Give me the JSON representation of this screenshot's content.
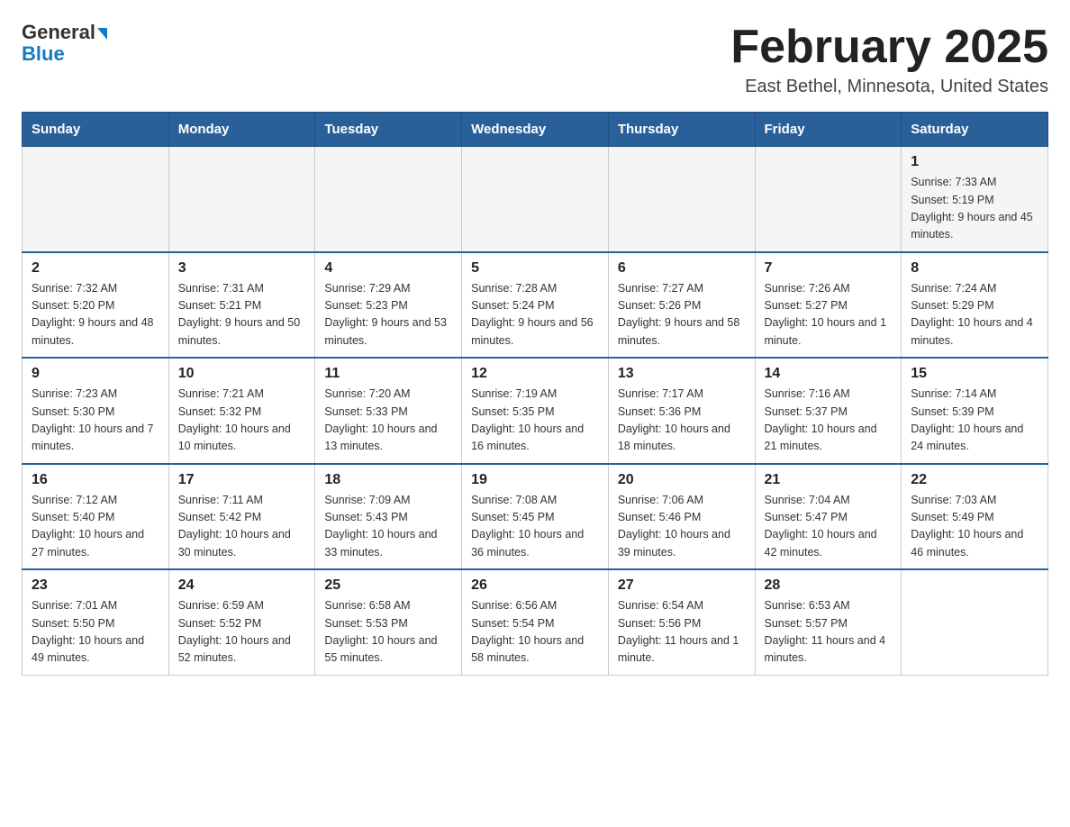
{
  "logo": {
    "line1": "General",
    "line2": "Blue"
  },
  "title": "February 2025",
  "subtitle": "East Bethel, Minnesota, United States",
  "weekdays": [
    "Sunday",
    "Monday",
    "Tuesday",
    "Wednesday",
    "Thursday",
    "Friday",
    "Saturday"
  ],
  "weeks": [
    [
      {
        "day": "",
        "info": ""
      },
      {
        "day": "",
        "info": ""
      },
      {
        "day": "",
        "info": ""
      },
      {
        "day": "",
        "info": ""
      },
      {
        "day": "",
        "info": ""
      },
      {
        "day": "",
        "info": ""
      },
      {
        "day": "1",
        "info": "Sunrise: 7:33 AM\nSunset: 5:19 PM\nDaylight: 9 hours and 45 minutes."
      }
    ],
    [
      {
        "day": "2",
        "info": "Sunrise: 7:32 AM\nSunset: 5:20 PM\nDaylight: 9 hours and 48 minutes."
      },
      {
        "day": "3",
        "info": "Sunrise: 7:31 AM\nSunset: 5:21 PM\nDaylight: 9 hours and 50 minutes."
      },
      {
        "day": "4",
        "info": "Sunrise: 7:29 AM\nSunset: 5:23 PM\nDaylight: 9 hours and 53 minutes."
      },
      {
        "day": "5",
        "info": "Sunrise: 7:28 AM\nSunset: 5:24 PM\nDaylight: 9 hours and 56 minutes."
      },
      {
        "day": "6",
        "info": "Sunrise: 7:27 AM\nSunset: 5:26 PM\nDaylight: 9 hours and 58 minutes."
      },
      {
        "day": "7",
        "info": "Sunrise: 7:26 AM\nSunset: 5:27 PM\nDaylight: 10 hours and 1 minute."
      },
      {
        "day": "8",
        "info": "Sunrise: 7:24 AM\nSunset: 5:29 PM\nDaylight: 10 hours and 4 minutes."
      }
    ],
    [
      {
        "day": "9",
        "info": "Sunrise: 7:23 AM\nSunset: 5:30 PM\nDaylight: 10 hours and 7 minutes."
      },
      {
        "day": "10",
        "info": "Sunrise: 7:21 AM\nSunset: 5:32 PM\nDaylight: 10 hours and 10 minutes."
      },
      {
        "day": "11",
        "info": "Sunrise: 7:20 AM\nSunset: 5:33 PM\nDaylight: 10 hours and 13 minutes."
      },
      {
        "day": "12",
        "info": "Sunrise: 7:19 AM\nSunset: 5:35 PM\nDaylight: 10 hours and 16 minutes."
      },
      {
        "day": "13",
        "info": "Sunrise: 7:17 AM\nSunset: 5:36 PM\nDaylight: 10 hours and 18 minutes."
      },
      {
        "day": "14",
        "info": "Sunrise: 7:16 AM\nSunset: 5:37 PM\nDaylight: 10 hours and 21 minutes."
      },
      {
        "day": "15",
        "info": "Sunrise: 7:14 AM\nSunset: 5:39 PM\nDaylight: 10 hours and 24 minutes."
      }
    ],
    [
      {
        "day": "16",
        "info": "Sunrise: 7:12 AM\nSunset: 5:40 PM\nDaylight: 10 hours and 27 minutes."
      },
      {
        "day": "17",
        "info": "Sunrise: 7:11 AM\nSunset: 5:42 PM\nDaylight: 10 hours and 30 minutes."
      },
      {
        "day": "18",
        "info": "Sunrise: 7:09 AM\nSunset: 5:43 PM\nDaylight: 10 hours and 33 minutes."
      },
      {
        "day": "19",
        "info": "Sunrise: 7:08 AM\nSunset: 5:45 PM\nDaylight: 10 hours and 36 minutes."
      },
      {
        "day": "20",
        "info": "Sunrise: 7:06 AM\nSunset: 5:46 PM\nDaylight: 10 hours and 39 minutes."
      },
      {
        "day": "21",
        "info": "Sunrise: 7:04 AM\nSunset: 5:47 PM\nDaylight: 10 hours and 42 minutes."
      },
      {
        "day": "22",
        "info": "Sunrise: 7:03 AM\nSunset: 5:49 PM\nDaylight: 10 hours and 46 minutes."
      }
    ],
    [
      {
        "day": "23",
        "info": "Sunrise: 7:01 AM\nSunset: 5:50 PM\nDaylight: 10 hours and 49 minutes."
      },
      {
        "day": "24",
        "info": "Sunrise: 6:59 AM\nSunset: 5:52 PM\nDaylight: 10 hours and 52 minutes."
      },
      {
        "day": "25",
        "info": "Sunrise: 6:58 AM\nSunset: 5:53 PM\nDaylight: 10 hours and 55 minutes."
      },
      {
        "day": "26",
        "info": "Sunrise: 6:56 AM\nSunset: 5:54 PM\nDaylight: 10 hours and 58 minutes."
      },
      {
        "day": "27",
        "info": "Sunrise: 6:54 AM\nSunset: 5:56 PM\nDaylight: 11 hours and 1 minute."
      },
      {
        "day": "28",
        "info": "Sunrise: 6:53 AM\nSunset: 5:57 PM\nDaylight: 11 hours and 4 minutes."
      },
      {
        "day": "",
        "info": ""
      }
    ]
  ]
}
